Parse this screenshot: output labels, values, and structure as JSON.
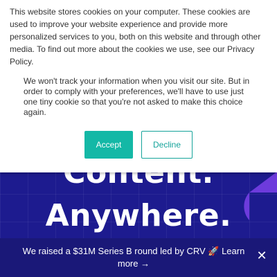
{
  "cookie_banner": {
    "text_primary": "This website stores cookies on your computer. These cookies are used to improve your website experience and provide more personalized services to you, both on this website and through other media. To find out more about the cookies we use, see our Privacy Policy.",
    "text_secondary": "We won't track your information when you visit our site. But in order to comply with your preferences, we'll have to use just one tiny cookie so that you're not asked to make this choice again.",
    "accept_label": "Accept",
    "decline_label": "Decline"
  },
  "hero": {
    "line_1": "Content.",
    "line_2": "Anywhere."
  },
  "announcement": {
    "text": "We raised a $31M Series B round led by CRV 🚀 ",
    "link_label": "Learn more →",
    "close_icon": "close-icon"
  },
  "colors": {
    "hero_bg": "#1d1b8f",
    "accent": "#14b8a6",
    "announce_bg": "#1a1878",
    "deco_purple": "#6d3bdc"
  }
}
